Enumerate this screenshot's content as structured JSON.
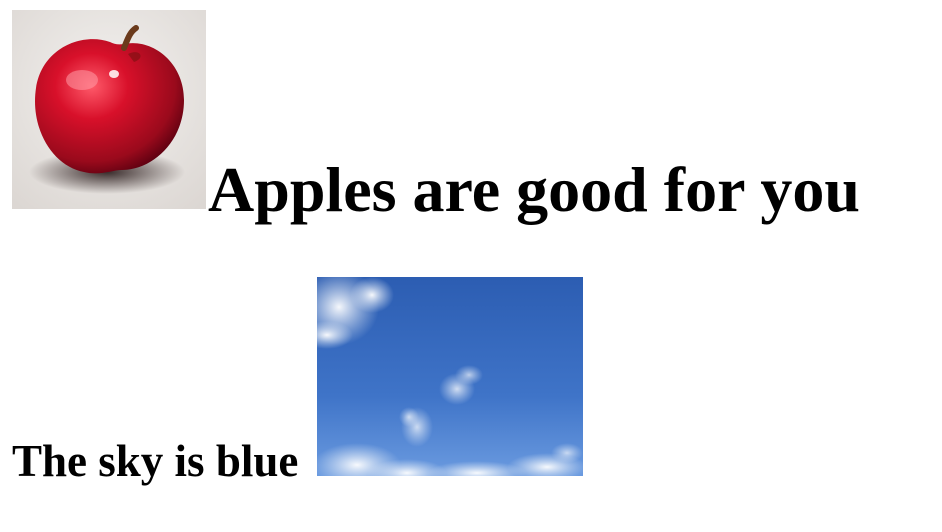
{
  "apple_section": {
    "image_icon": "apple-photo",
    "heading": "Apples are good for you"
  },
  "sky_section": {
    "heading": "The sky is blue",
    "image_icon": "sky-photo"
  },
  "colors": {
    "apple_red": "#c8102e",
    "apple_dark": "#6b0010",
    "apple_bg": "#e9e6e3",
    "sky_top": "#2e5fb3",
    "sky_bottom": "#5b8fda",
    "cloud": "#e8eef6"
  }
}
